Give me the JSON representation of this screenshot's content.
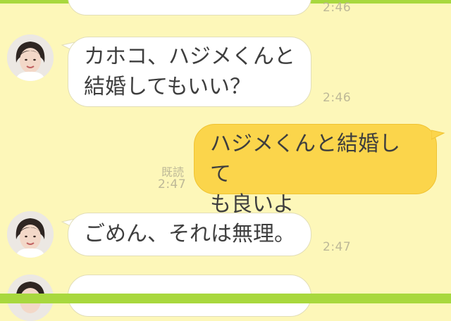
{
  "header": {
    "partial_time": "2:46"
  },
  "messages": [
    {
      "sender": "other",
      "text_lines": [
        "カホコ、ハジメくんと",
        "結婚してもいい？"
      ],
      "time": "2:46"
    },
    {
      "sender": "me",
      "text_lines": [
        "ハジメくんと結婚して",
        "も良いよ"
      ],
      "read_label": "既読",
      "time": "2:47"
    },
    {
      "sender": "other",
      "text_lines": [
        "ごめん、それは無理。"
      ],
      "time": "2:47"
    }
  ],
  "colors": {
    "background": "#fdf7b9",
    "accent_bar": "#a8d83e",
    "bubble_other": "#ffffff",
    "bubble_me": "#fbd54b",
    "meta_text": "#bdb897"
  },
  "icons": [
    "user-avatar"
  ]
}
